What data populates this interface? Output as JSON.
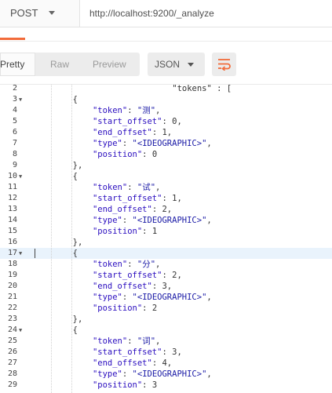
{
  "request": {
    "method": "POST",
    "url": "http://localhost:9200/_analyze"
  },
  "view": {
    "modes": [
      "Pretty",
      "Raw",
      "Preview"
    ],
    "active_mode": "Pretty",
    "format": "JSON",
    "wrap_icon": "wrap-lines-icon"
  },
  "editor": {
    "top_partial": "tokens\" : [",
    "tokens": [
      {
        "token": "测",
        "start_offset": "0",
        "end_offset": "1",
        "type": "<IDEOGRAPHIC>",
        "position": "0"
      },
      {
        "token": "试",
        "start_offset": "1",
        "end_offset": "2",
        "type": "<IDEOGRAPHIC>",
        "position": "1"
      },
      {
        "token": "分",
        "start_offset": "2",
        "end_offset": "3",
        "type": "<IDEOGRAPHIC>",
        "position": "2"
      },
      {
        "token": "词",
        "start_offset": "3",
        "end_offset": "4",
        "type": "<IDEOGRAPHIC>",
        "position": "3"
      }
    ],
    "line_numbers": [
      "2",
      "3",
      "4",
      "5",
      "6",
      "7",
      "8",
      "9",
      "10",
      "11",
      "12",
      "13",
      "14",
      "15",
      "16",
      "17",
      "18",
      "19",
      "20",
      "21",
      "22",
      "23",
      "24",
      "25",
      "26",
      "27",
      "28",
      "29"
    ],
    "active_line": "17",
    "colors": {
      "accent": "#f26b3a",
      "active_line": "#e9f3fc"
    }
  }
}
